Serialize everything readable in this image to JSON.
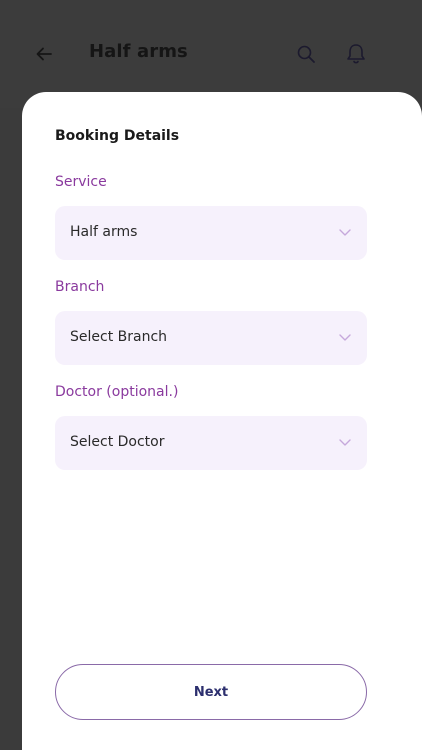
{
  "header": {
    "title": "Half arms",
    "icons": [
      "back-arrow-icon",
      "search-icon",
      "bell-icon"
    ]
  },
  "booking": {
    "section_title": "Booking Details",
    "service": {
      "label": "Service",
      "value": "Half arms"
    },
    "branch": {
      "label": "Branch",
      "value": "Select Branch"
    },
    "doctor": {
      "label": "Doctor (optional.)",
      "value": "Select Doctor"
    }
  },
  "actions": {
    "next_label": "Next"
  },
  "colors": {
    "accent": "#8a3a9e",
    "field_bg": "#f6f1fc",
    "overlay": "#3c3c3c",
    "button_text": "#2c2f6e"
  }
}
